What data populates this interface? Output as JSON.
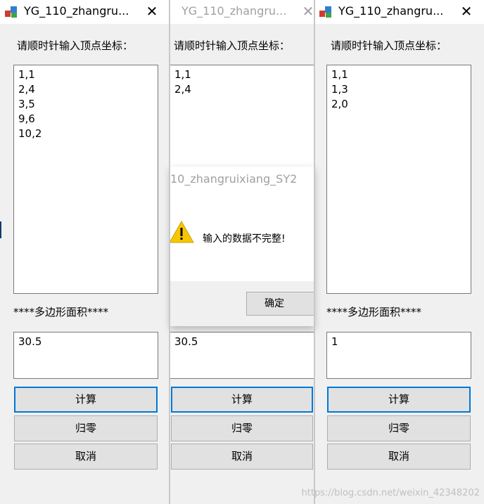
{
  "windows": [
    {
      "title": "YG_110_zhangru...",
      "close_glyph": "✕",
      "prompt": "请顺时针输入顶点坐标：",
      "coords": [
        "1,1",
        "2,4",
        "3,5",
        "9,6",
        "10,2"
      ],
      "area_label": "****多边形面积****",
      "area_value": "30.5",
      "buttons": {
        "calc": "计算",
        "reset": "归零",
        "cancel": "取消"
      }
    },
    {
      "title": "YG_110_zhangru...",
      "close_glyph": "✕",
      "prompt": "请顺时针输入顶点坐标：",
      "coords": [
        "1,1",
        "2,4"
      ],
      "area_value": "30.5",
      "buttons": {
        "calc": "计算",
        "reset": "归零",
        "cancel": "取消"
      }
    },
    {
      "title": "YG_110_zhangru...",
      "close_glyph": "✕",
      "prompt": "请顺时针输入顶点坐标：",
      "coords": [
        "1,1",
        "1,3",
        "2,0"
      ],
      "area_label": "****多边形面积****",
      "area_value": "1",
      "buttons": {
        "calc": "计算",
        "reset": "归零",
        "cancel": "取消"
      }
    }
  ],
  "dialog": {
    "title": "10_zhangruixiang_SY2",
    "message": "输入的数据不完整!",
    "ok_label": "确定",
    "icon": "warning-icon"
  },
  "watermark": "https://blog.csdn.net/weixin_42348202",
  "colors": {
    "accent": "#0078d7",
    "window_bg": "#f0f0f0",
    "button_bg": "#e1e1e1"
  }
}
